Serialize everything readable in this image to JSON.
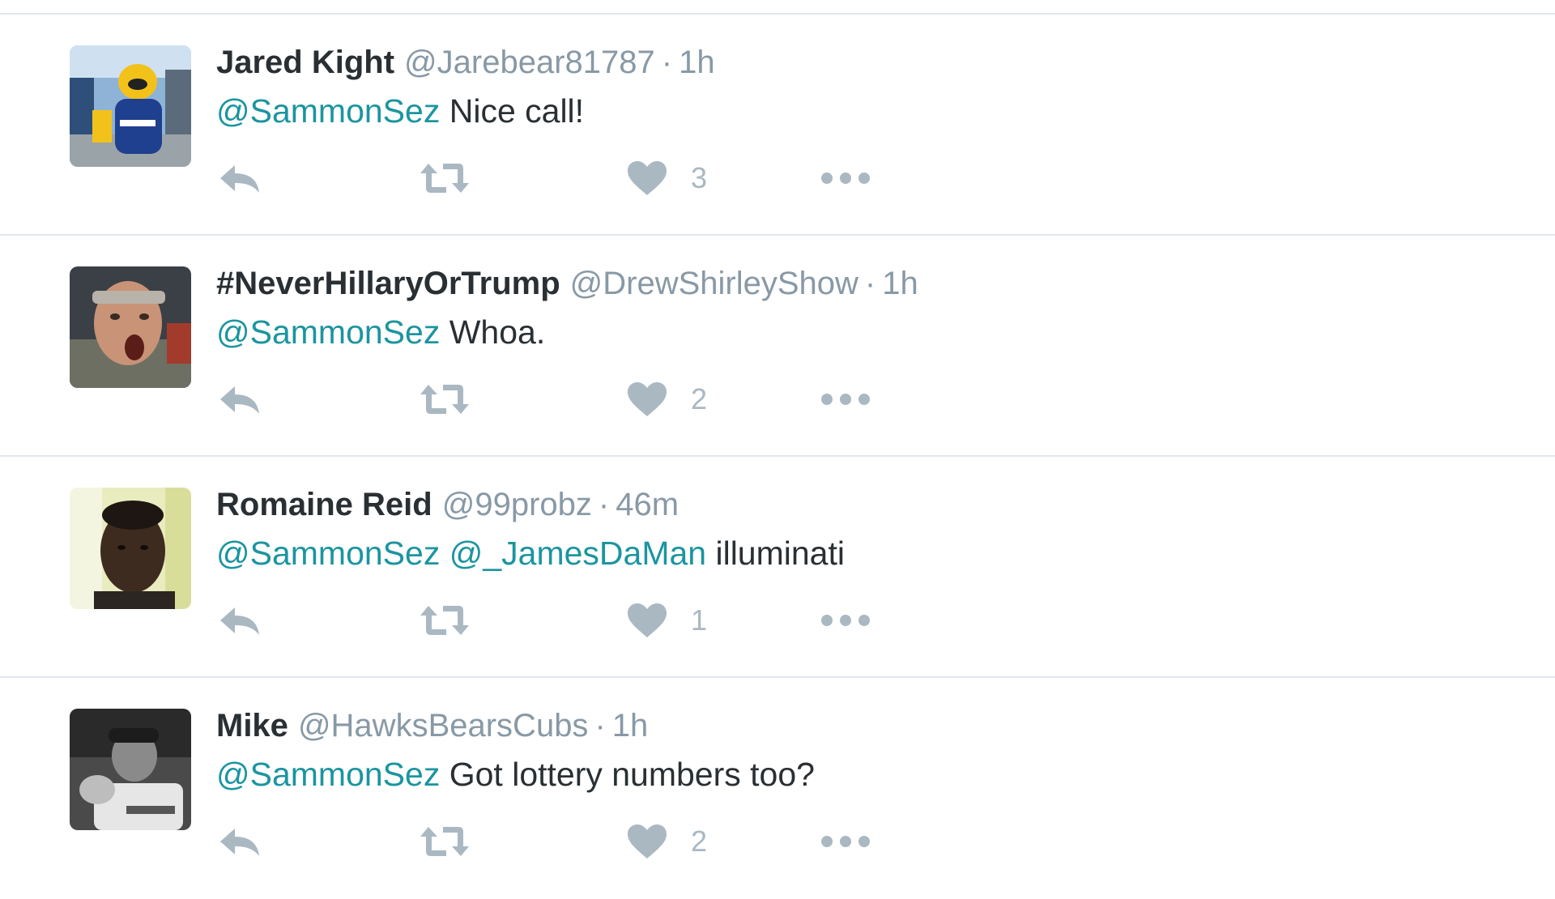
{
  "tweets": [
    {
      "fullname": "Jared Kight",
      "username": "@Jarebear81787",
      "separator": "·",
      "time": "1h",
      "mentions": [
        "@SammonSez"
      ],
      "text": " Nice call!",
      "likes": "3",
      "avatar": "mascot-avatar"
    },
    {
      "fullname": "#NeverHillaryOrTrump",
      "username": "@DrewShirleyShow",
      "separator": "·",
      "time": "1h",
      "mentions": [
        "@SammonSez"
      ],
      "text": " Whoa.",
      "likes": "2",
      "avatar": "shouting-man-avatar"
    },
    {
      "fullname": "Romaine Reid",
      "username": "@99probz",
      "separator": "·",
      "time": "46m",
      "mentions": [
        "@SammonSez",
        " @_JamesDaMan"
      ],
      "text": " illuminati",
      "likes": "1",
      "avatar": "portrait-avatar"
    },
    {
      "fullname": "Mike",
      "username": "@HawksBearsCubs",
      "separator": "·",
      "time": "1h",
      "mentions": [
        "@SammonSez"
      ],
      "text": " Got lottery numbers too?",
      "likes": "2",
      "avatar": "baseball-player-avatar"
    }
  ],
  "icons": {
    "reply": "reply-icon",
    "retweet": "retweet-icon",
    "like": "heart-icon",
    "more": "more-icon"
  },
  "colors": {
    "mention": "#1b95a0",
    "muted": "#8899a6",
    "icon": "#aab8c2",
    "divider": "#e1e8ed"
  }
}
